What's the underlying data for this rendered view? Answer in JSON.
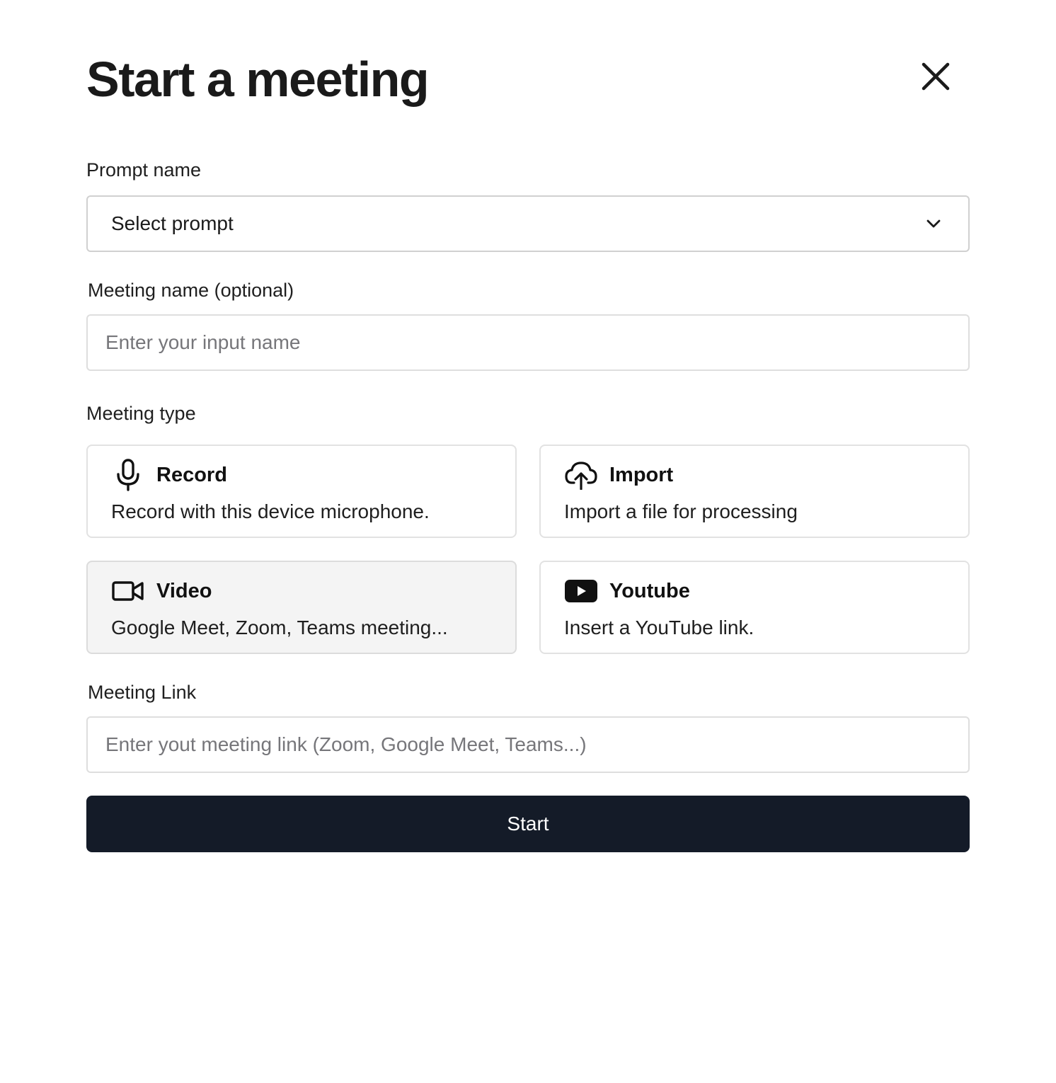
{
  "dialog": {
    "title": "Start a meeting",
    "close_icon": "close-icon"
  },
  "prompt": {
    "label": "Prompt name",
    "selected_value": "Select prompt",
    "icon": "chevron-down-icon"
  },
  "meeting_name": {
    "label": "Meeting name (optional)",
    "value": "",
    "placeholder": "Enter your input name"
  },
  "meeting_type": {
    "label": "Meeting type",
    "selected": "Video",
    "options": [
      {
        "title": "Record",
        "description": "Record with this device microphone.",
        "icon": "microphone-icon"
      },
      {
        "title": "Import",
        "description": "Import a file for processing",
        "icon": "cloud-upload-icon"
      },
      {
        "title": "Video",
        "description": "Google Meet, Zoom, Teams meeting...",
        "icon": "video-camera-icon"
      },
      {
        "title": "Youtube",
        "description": "Insert a YouTube link.",
        "icon": "youtube-icon"
      }
    ]
  },
  "meeting_link": {
    "label": "Meeting Link",
    "value": "",
    "placeholder": "Enter yout meeting link (Zoom, Google Meet, Teams...)"
  },
  "actions": {
    "start_label": "Start"
  },
  "colors": {
    "primary_button": "#141b28",
    "selected_card": "#f4f4f4",
    "border": "#dedede",
    "placeholder": "#76767a"
  }
}
